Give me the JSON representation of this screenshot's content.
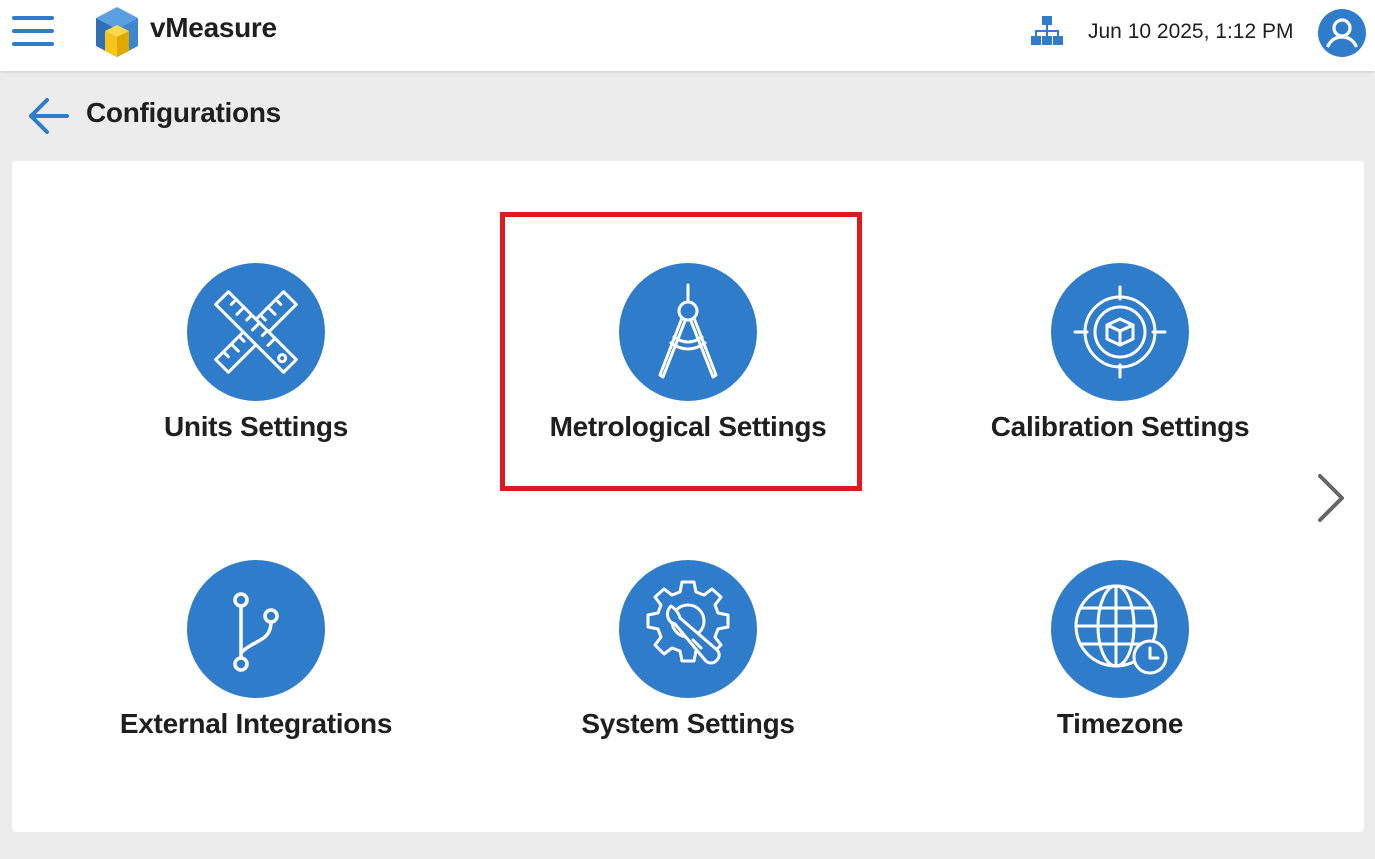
{
  "app": {
    "brand": "vMeasure",
    "datetime": "Jun 10 2025, 1:12 PM"
  },
  "page": {
    "title": "Configurations"
  },
  "tiles": [
    {
      "label": "Units Settings",
      "icon": "ruler-cross-icon"
    },
    {
      "label": "Metrological Settings",
      "icon": "compass-icon"
    },
    {
      "label": "Calibration Settings",
      "icon": "target-box-icon"
    },
    {
      "label": "External Integrations",
      "icon": "branch-icon"
    },
    {
      "label": "System Settings",
      "icon": "gear-wrench-icon"
    },
    {
      "label": "Timezone",
      "icon": "globe-clock-icon"
    }
  ],
  "colors": {
    "accent": "#2f7ccb",
    "highlight": "#e0191d",
    "background": "#ececec"
  }
}
